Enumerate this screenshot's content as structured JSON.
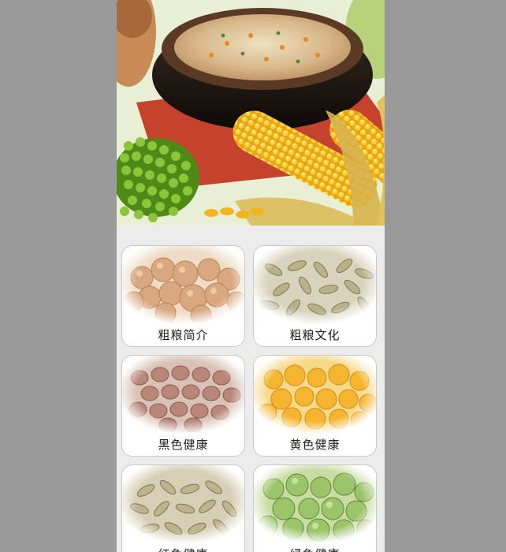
{
  "banner": {
    "image": "porridge-corn-beans-banner"
  },
  "cards": [
    {
      "label": "粗粮简介",
      "image": "chickpeas"
    },
    {
      "label": "粗粮文化",
      "image": "pumpkin-seeds"
    },
    {
      "label": "黑色健康",
      "image": "brown-lentils"
    },
    {
      "label": "黄色健康",
      "image": "yellow-split-peas"
    },
    {
      "label": "红色健康",
      "image": "pumpkin-seeds"
    },
    {
      "label": "绿色健康",
      "image": "green-peas"
    }
  ],
  "colors": {
    "page_bg": "#9a9a9a",
    "content_bg": "#ececec",
    "card_bg": "#ffffff",
    "card_border": "#c8c8c8",
    "label_text": "#222222"
  }
}
